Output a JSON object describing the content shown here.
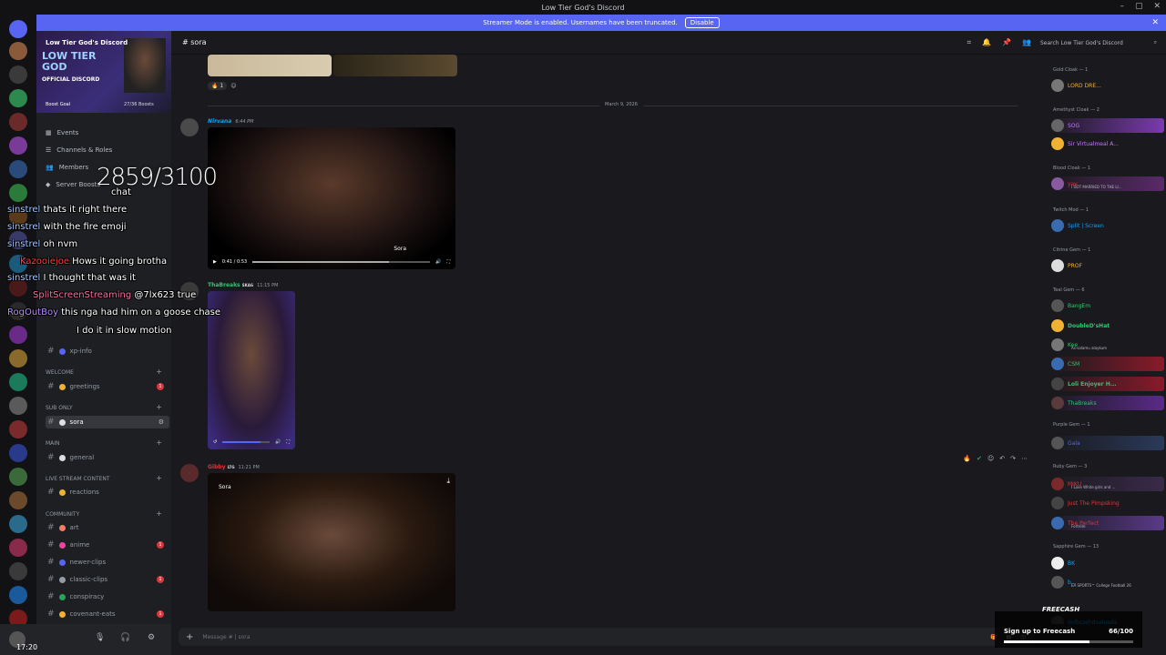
{
  "window": {
    "title": "Low Tier God's Discord"
  },
  "banner": {
    "text": "Streamer Mode is enabled. Usernames have been truncated.",
    "disable": "Disable"
  },
  "server": {
    "name": "Low Tier God's Discord",
    "logo_text": "LOW TIER GOD",
    "logo_sub": "OFFICIAL DISCORD",
    "boost_label": "Boost Goal",
    "boost_count": "27/36 Boosts",
    "boost_progress": 0.75
  },
  "nav": {
    "events": "Events",
    "channels_roles": "Channels & Roles",
    "members": "Members",
    "server_boosts": "Server Boosts"
  },
  "channels": {
    "xp_info": "xp-info",
    "cat_welcome": "WELCOME",
    "greetings": "greetings",
    "cat_sub": "SUB ONLY",
    "sora": "sora",
    "cat_main": "MAIN",
    "general": "general",
    "cat_live": "LIVE STREAM CONTENT",
    "reactions": "reactions",
    "cat_community": "COMMUNITY",
    "art": "art",
    "anime": "anime",
    "newer_clips": "newer-clips",
    "classic_clips": "classic-clips",
    "conspiracy": "conspiracy",
    "covenant_eats": "covenant-eats"
  },
  "header": {
    "channel": "sora",
    "search": "Search Low Tier God's Discord"
  },
  "chat": {
    "date_divider": "March 9, 2026",
    "reaction_count": "1",
    "msg1": {
      "user": "Nirvana",
      "time": "6:44 PM",
      "video_time": "0:41 / 0:53",
      "watermark": "Sora"
    },
    "msg2": {
      "user": "ThaBreaks",
      "tag": "SKAG",
      "time": "11:15 PM"
    },
    "msg3": {
      "user": "Gibby",
      "tag": "LTG",
      "time": "11:21 PM",
      "watermark": "Sora"
    },
    "input_placeholder": "Message # | sora"
  },
  "members": {
    "gold": "Gold Cloak — 1",
    "gold_m1": "LORD DRE...",
    "amethyst": "Amethyst Cloak — 2",
    "am_m1": "SOG",
    "am_m2": "Sir Virtualmeal A...",
    "blood": "Blood Cloak — 1",
    "blood_m1": "yay",
    "blood_sub": "I GOT MARRIED TO THE LI...",
    "twitch": "Twitch Mod — 1",
    "twitch_m1": "Split | Screen",
    "citrine": "Citrine Gem — 1",
    "citrine_m1": "PROF",
    "teal": "Teal Gem — 6",
    "teal_m1": "BangEm",
    "teal_m2": "DoubleD'sHat",
    "teal_m3": "Kee",
    "teal_m3_sub": "As-salamu alaykum",
    "teal_m4": "CSM",
    "teal_m5": "Loli Enjoyer H...",
    "teal_m6": "ThaBreaks",
    "purple": "Purple Gem — 1",
    "purple_m1": "Gala",
    "ruby": "Ruby Gem — 3",
    "ruby_m1": "MIKU",
    "ruby_m1_sub": "I Love White girls and ...",
    "ruby_m2": "Just The Pimpsking",
    "ruby_m3": "The Perfect",
    "ruby_m3_sub": "Fortnite",
    "sapphire": "Sapphire Gem — 13",
    "sapphire_m1": "BK",
    "sapphire_m2": "EA SPORTS™ College Football 26",
    "sapphire_m3": "dylbcashdyaluada"
  },
  "overlay": {
    "counter": "2859/3100",
    "lines": [
      {
        "user": "",
        "msg": "chat"
      },
      {
        "user": "sinstrel",
        "msg": "thats it right there"
      },
      {
        "user": "sinstrel",
        "msg": "with the fire emoji"
      },
      {
        "user": "sinstrel",
        "msg": "oh nvm"
      },
      {
        "user": "Kazooiejoe",
        "msg": "Hows it going brotha"
      },
      {
        "user": "sinstrel",
        "msg": "I thought that was it"
      },
      {
        "user": "SplitScreenStreaming",
        "msg": "@7lx623 true"
      },
      {
        "user": "RogOutBoy",
        "msg": "this nga had him on a goose chase"
      },
      {
        "user": "",
        "msg": "I do it in slow motion"
      }
    ],
    "freecash_logo": "FREECASH",
    "freecash_label": "Sign up to Freecash",
    "freecash_count": "66/100",
    "freecash_progress": 0.66,
    "corner": "17:20"
  },
  "colors": {
    "blurple": "#5865f2",
    "teal": "#2dc770",
    "red": "#da373c",
    "pink": "#eb459e"
  }
}
